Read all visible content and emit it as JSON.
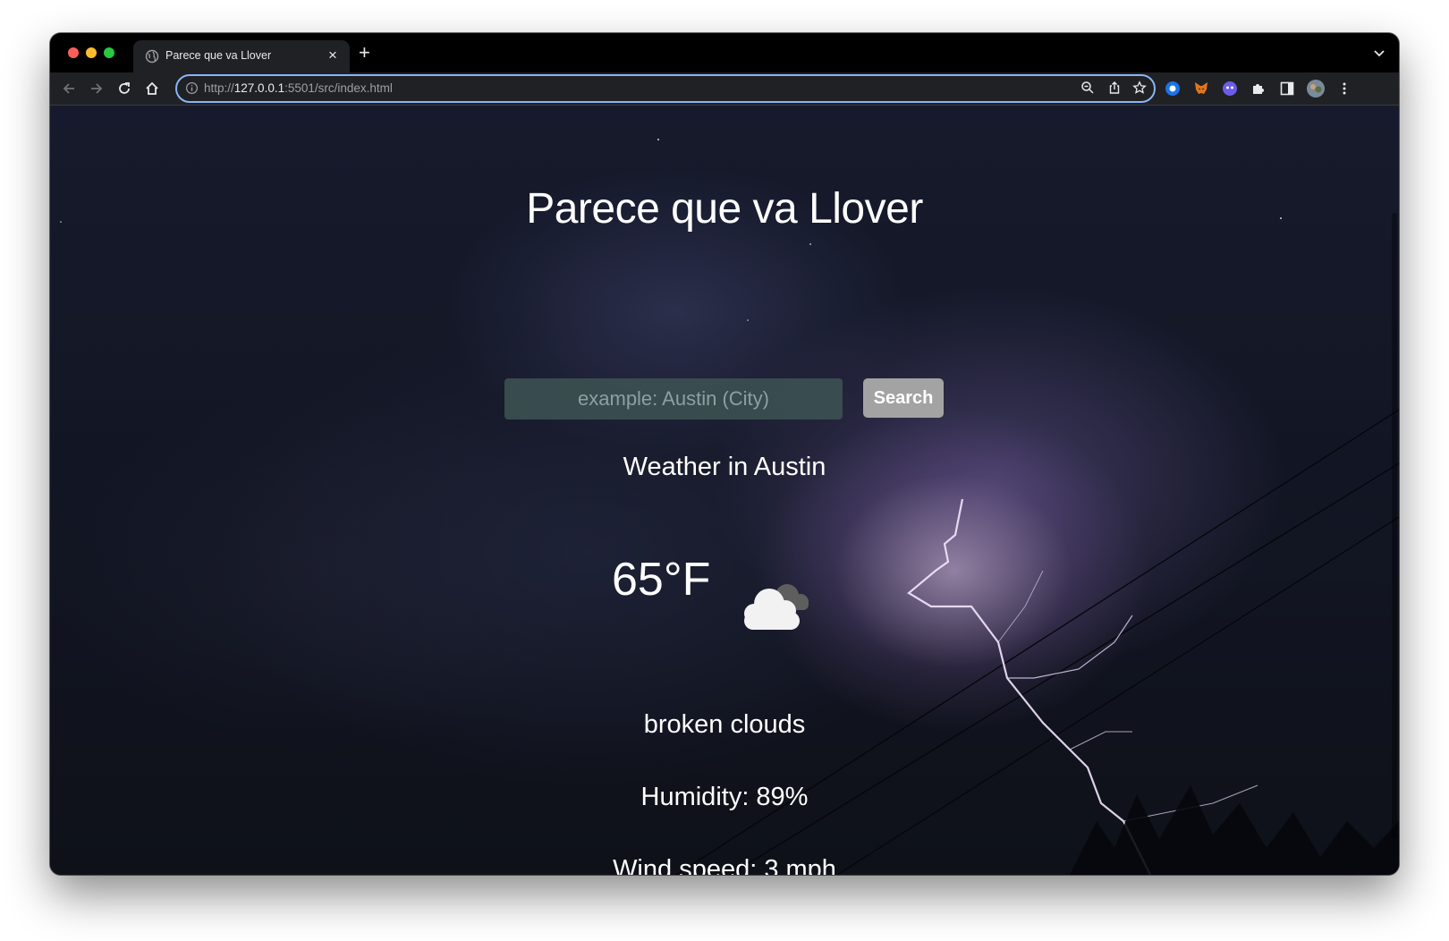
{
  "browser": {
    "tab_title": "Parece que va Llover",
    "new_tab_label": "+",
    "close_tab_label": "×",
    "url": {
      "scheme": "http://",
      "host": "127.0.0.1",
      "rest": ":5501/src/index.html"
    }
  },
  "page": {
    "heading": "Parece que va Llover",
    "search": {
      "placeholder": "example: Austin (City)",
      "value": "",
      "button_label": "Search"
    },
    "weather": {
      "city_label": "Weather in Austin",
      "temperature": "65°F",
      "icon": "broken-clouds-icon",
      "description": "broken clouds",
      "humidity": "Humidity: 89%",
      "wind": "Wind speed: 3 mph"
    }
  },
  "colors": {
    "accent": "#8ab4f8",
    "page_text": "#ffffff",
    "button_bg": "#a3a3a3",
    "input_bg": "#3c5252"
  }
}
